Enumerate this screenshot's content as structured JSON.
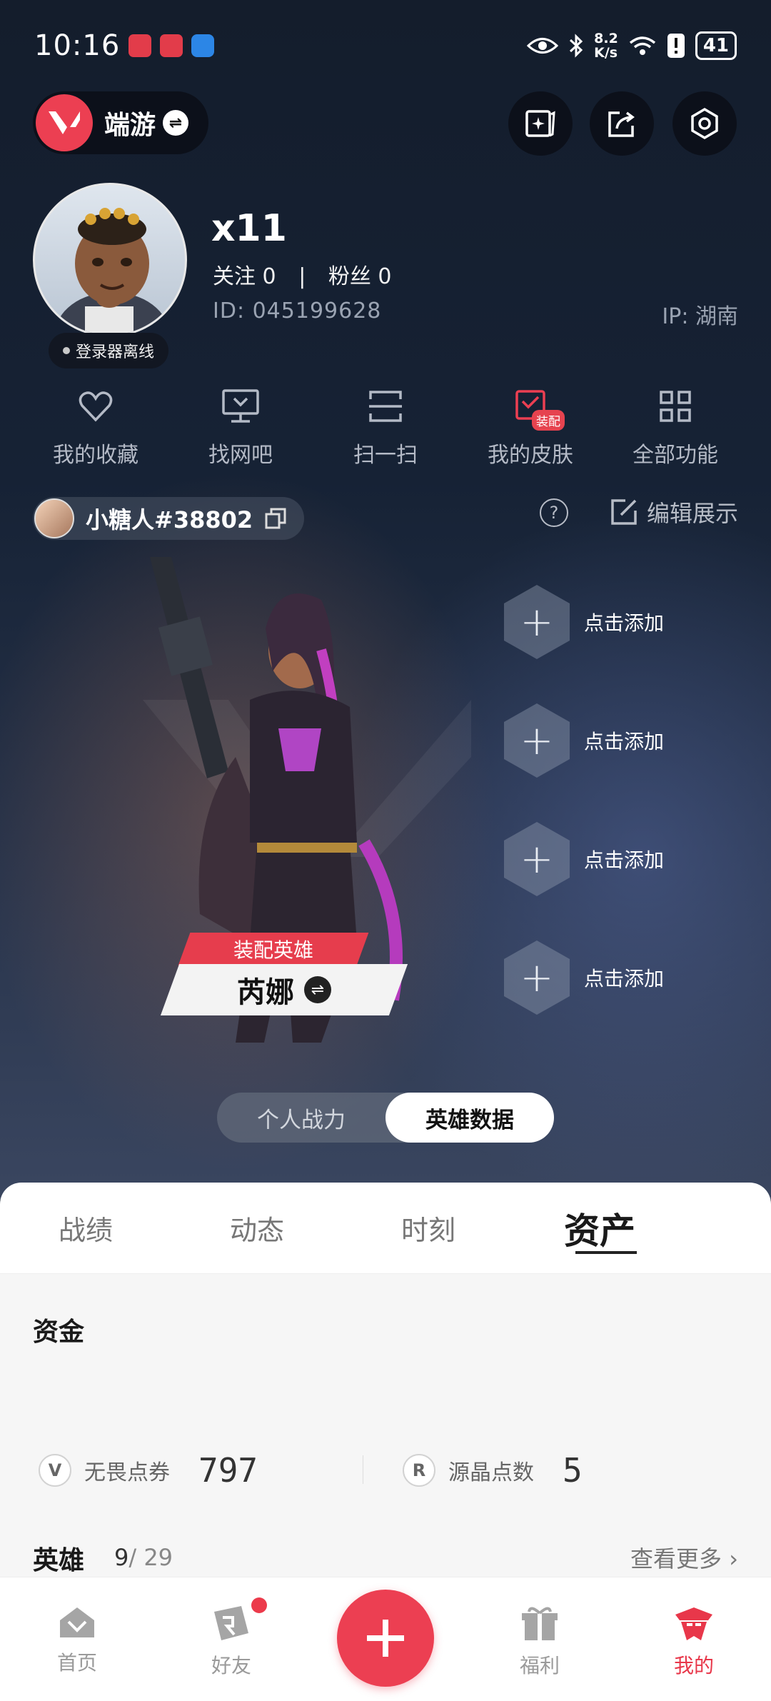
{
  "status_bar": {
    "time": "10:16",
    "net_speed_top": "8.2",
    "net_speed_bottom": "K/s",
    "battery": "41"
  },
  "header": {
    "app_name": "端游"
  },
  "profile": {
    "username": "x11",
    "following_label": "关注",
    "following": "0",
    "followers_label": "粉丝",
    "followers": "0",
    "id_text": "ID:  045199628",
    "ip_text": "IP:  湖南",
    "online_status": "登录器离线"
  },
  "quick_actions": [
    {
      "label": "我的收藏",
      "icon": "heart-icon"
    },
    {
      "label": "找网吧",
      "icon": "monitor-icon"
    },
    {
      "label": "扫一扫",
      "icon": "scan-icon"
    },
    {
      "label": "我的皮肤",
      "icon": "skin-icon",
      "badge": "装配"
    },
    {
      "label": "全部功能",
      "icon": "grid-icon"
    }
  ],
  "game_account": {
    "name": "小糖人#38802"
  },
  "edit_display": "编辑展示",
  "showcase": {
    "equip_label": "装配英雄",
    "agent_name": "芮娜",
    "add_slots": [
      "点击添加",
      "点击添加",
      "点击添加",
      "点击添加"
    ]
  },
  "toggle": {
    "left": "个人战力",
    "right": "英雄数据",
    "active": "right"
  },
  "tabs": [
    "战绩",
    "动态",
    "时刻",
    "资产"
  ],
  "active_tab": "资产",
  "assets": {
    "funds_title": "资金",
    "vp_label": "无畏点券",
    "vp_value": "797",
    "rp_label": "源晶点数",
    "rp_value": "5",
    "heroes_title": "英雄",
    "heroes_owned": "9",
    "heroes_total": "/ 29",
    "see_more": "查看更多"
  },
  "bottom_nav": [
    {
      "label": "首页",
      "icon": "home-icon"
    },
    {
      "label": "好友",
      "icon": "friends-icon"
    },
    {
      "label": "",
      "icon": "plus-icon"
    },
    {
      "label": "福利",
      "icon": "gift-icon"
    },
    {
      "label": "我的",
      "icon": "profile-icon"
    }
  ],
  "colors": {
    "accent": "#ec3f52",
    "bg_dark": "#141d2c",
    "sheet": "#ffffff"
  }
}
